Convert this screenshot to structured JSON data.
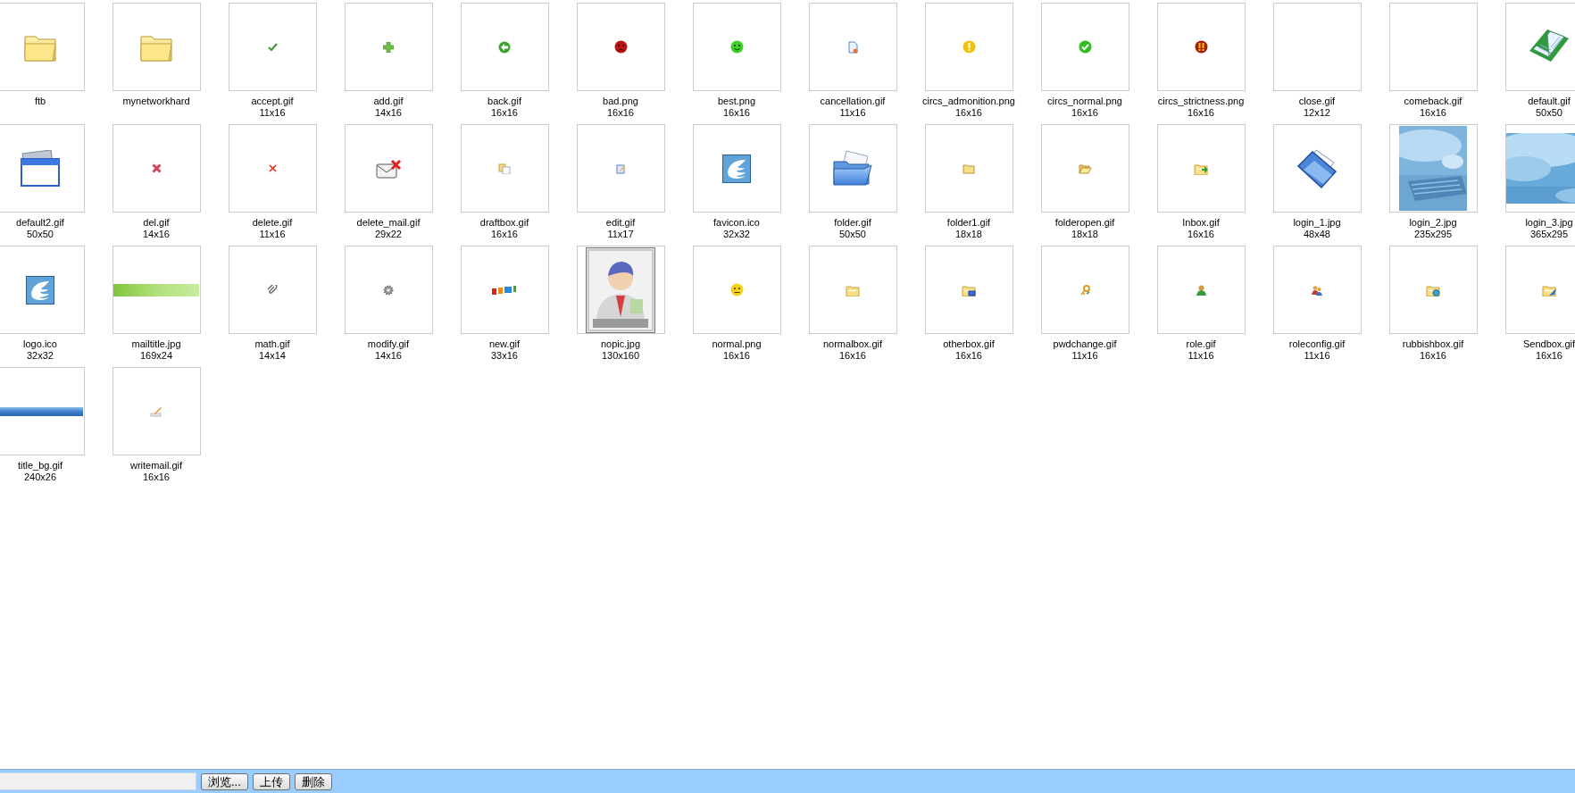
{
  "files": [
    {
      "name": "ftb",
      "kind": "folder"
    },
    {
      "name": "mynetworkhard",
      "kind": "folder"
    },
    {
      "name": "accept.gif",
      "size": "11x16",
      "kind": "check"
    },
    {
      "name": "add.gif",
      "size": "14x16",
      "kind": "plus"
    },
    {
      "name": "back.gif",
      "size": "16x16",
      "kind": "back"
    },
    {
      "name": "bad.png",
      "size": "16x16",
      "kind": "sad"
    },
    {
      "name": "best.png",
      "size": "16x16",
      "kind": "smile"
    },
    {
      "name": "cancellation.gif",
      "size": "11x16",
      "kind": "document"
    },
    {
      "name": "circs_admonition.png",
      "size": "16x16",
      "kind": "warning"
    },
    {
      "name": "circs_normal.png",
      "size": "16x16",
      "kind": "okay"
    },
    {
      "name": "circs_strictness.png",
      "size": "16x16",
      "kind": "alert"
    },
    {
      "name": "close.gif",
      "size": "12x12",
      "kind": "blank"
    },
    {
      "name": "comeback.gif",
      "size": "16x16",
      "kind": "blank"
    },
    {
      "name": "default.gif",
      "size": "50x50",
      "kind": "book"
    },
    {
      "name": "default2.gif",
      "size": "50x50",
      "kind": "window"
    },
    {
      "name": "del.gif",
      "size": "14x16",
      "kind": "cross"
    },
    {
      "name": "delete.gif",
      "size": "11x16",
      "kind": "x"
    },
    {
      "name": "delete_mail.gif",
      "size": "29x22",
      "kind": "mail"
    },
    {
      "name": "draftbox.gif",
      "size": "16x16",
      "kind": "copy"
    },
    {
      "name": "edit.gif",
      "size": "11x17",
      "kind": "edit"
    },
    {
      "name": "favicon.ico",
      "size": "32x32",
      "kind": "logo"
    },
    {
      "name": "folder.gif",
      "size": "50x50",
      "kind": "bigfolder"
    },
    {
      "name": "folder1.gif",
      "size": "18x18",
      "kind": "smallfolder"
    },
    {
      "name": "folderopen.gif",
      "size": "18x18",
      "kind": "openfolder"
    },
    {
      "name": "Inbox.gif",
      "size": "16x16",
      "kind": "inbox"
    },
    {
      "name": "login_1.jpg",
      "size": "48x48",
      "kind": "tiltfolder"
    },
    {
      "name": "login_2.jpg",
      "size": "235x295",
      "kind": "picture"
    },
    {
      "name": "login_3.jpg",
      "size": "365x295",
      "kind": "picture"
    },
    {
      "name": "logo.ico",
      "size": "32x32",
      "kind": "logo"
    },
    {
      "name": "mailtitle.jpg",
      "size": "169x24",
      "kind": "banner"
    },
    {
      "name": "math.gif",
      "size": "14x14",
      "kind": "clip"
    },
    {
      "name": "modify.gif",
      "size": "14x16",
      "kind": "gear"
    },
    {
      "name": "new.gif",
      "size": "33x16",
      "kind": "badge"
    },
    {
      "name": "nopic.jpg",
      "size": "130x160",
      "kind": "picture"
    },
    {
      "name": "normal.png",
      "size": "16x16",
      "kind": "neutral"
    },
    {
      "name": "normalbox.gif",
      "size": "16x16",
      "kind": "box"
    },
    {
      "name": "otherbox.gif",
      "size": "16x16",
      "kind": "screenbox"
    },
    {
      "name": "pwdchange.gif",
      "size": "11x16",
      "kind": "key"
    },
    {
      "name": "role.gif",
      "size": "11x16",
      "kind": "person"
    },
    {
      "name": "roleconfig.gif",
      "size": "11x16",
      "kind": "people"
    },
    {
      "name": "rubbishbox.gif",
      "size": "16x16",
      "kind": "recycle"
    },
    {
      "name": "Sendbox.gif",
      "size": "16x16",
      "kind": "send"
    },
    {
      "name": "title_bg.gif",
      "size": "240x26",
      "kind": "bar"
    },
    {
      "name": "writemail.gif",
      "size": "16x16",
      "kind": "pencil"
    }
  ],
  "upload": {
    "buttons": [
      "浏览...",
      "上传",
      "删除"
    ]
  }
}
